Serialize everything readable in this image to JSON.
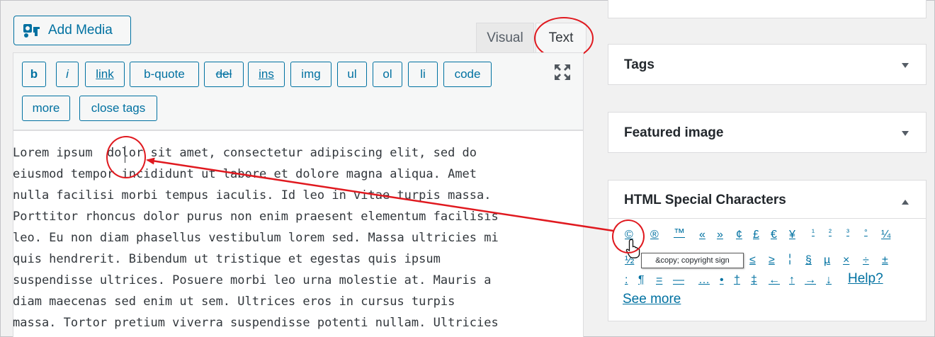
{
  "editor": {
    "add_media_label": "Add Media",
    "tabs": {
      "visual": "Visual",
      "text": "Text"
    },
    "quicktags": [
      "b",
      "i",
      "link",
      "b-quote",
      "del",
      "ins",
      "img",
      "ul",
      "ol",
      "li",
      "code",
      "more",
      "close tags"
    ],
    "content_lines": [
      "Lorem ipsum  dolor sit amet, consectetur adipiscing elit, sed do",
      "eiusmod tempor incididunt ut labore et dolore magna aliqua. Amet",
      "nulla facilisi morbi tempus iaculis. Id leo in vitae turpis massa.",
      "Porttitor rhoncus dolor purus non enim praesent elementum facilisis",
      "leo. Eu non diam phasellus vestibulum lorem sed. Massa ultricies mi",
      "quis hendrerit. Bibendum ut tristique et egestas quis ipsum",
      "suspendisse ultrices. Posuere morbi leo urna molestie at. Mauris a",
      "diam maecenas sed enim ut sem. Ultrices eros in cursus turpis",
      "massa. Tortor pretium viverra suspendisse potenti nullam. Ultricies"
    ]
  },
  "sidebar": {
    "tags_title": "Tags",
    "featured_image_title": "Featured image",
    "special_chars_title": "HTML Special Characters",
    "chars_row1": [
      "©",
      "®",
      "™",
      "«",
      "»",
      "¢",
      "£",
      "€",
      "¥",
      "¹",
      "²",
      "³",
      "°",
      "¼"
    ],
    "chars_row2": [
      "½",
      "≤",
      "≥",
      "¦",
      "§",
      "µ",
      "×",
      "÷",
      "±"
    ],
    "chars_row3": [
      ":",
      "¶",
      "=",
      "—",
      "…",
      "•",
      "†",
      "‡",
      "←",
      "↑",
      "→",
      "↓"
    ],
    "help_label": "Help?",
    "see_more_label": "See more",
    "tooltip": "&copy; copyright sign"
  },
  "colors": {
    "accent": "#0071a1",
    "annotation": "#e0191f"
  }
}
